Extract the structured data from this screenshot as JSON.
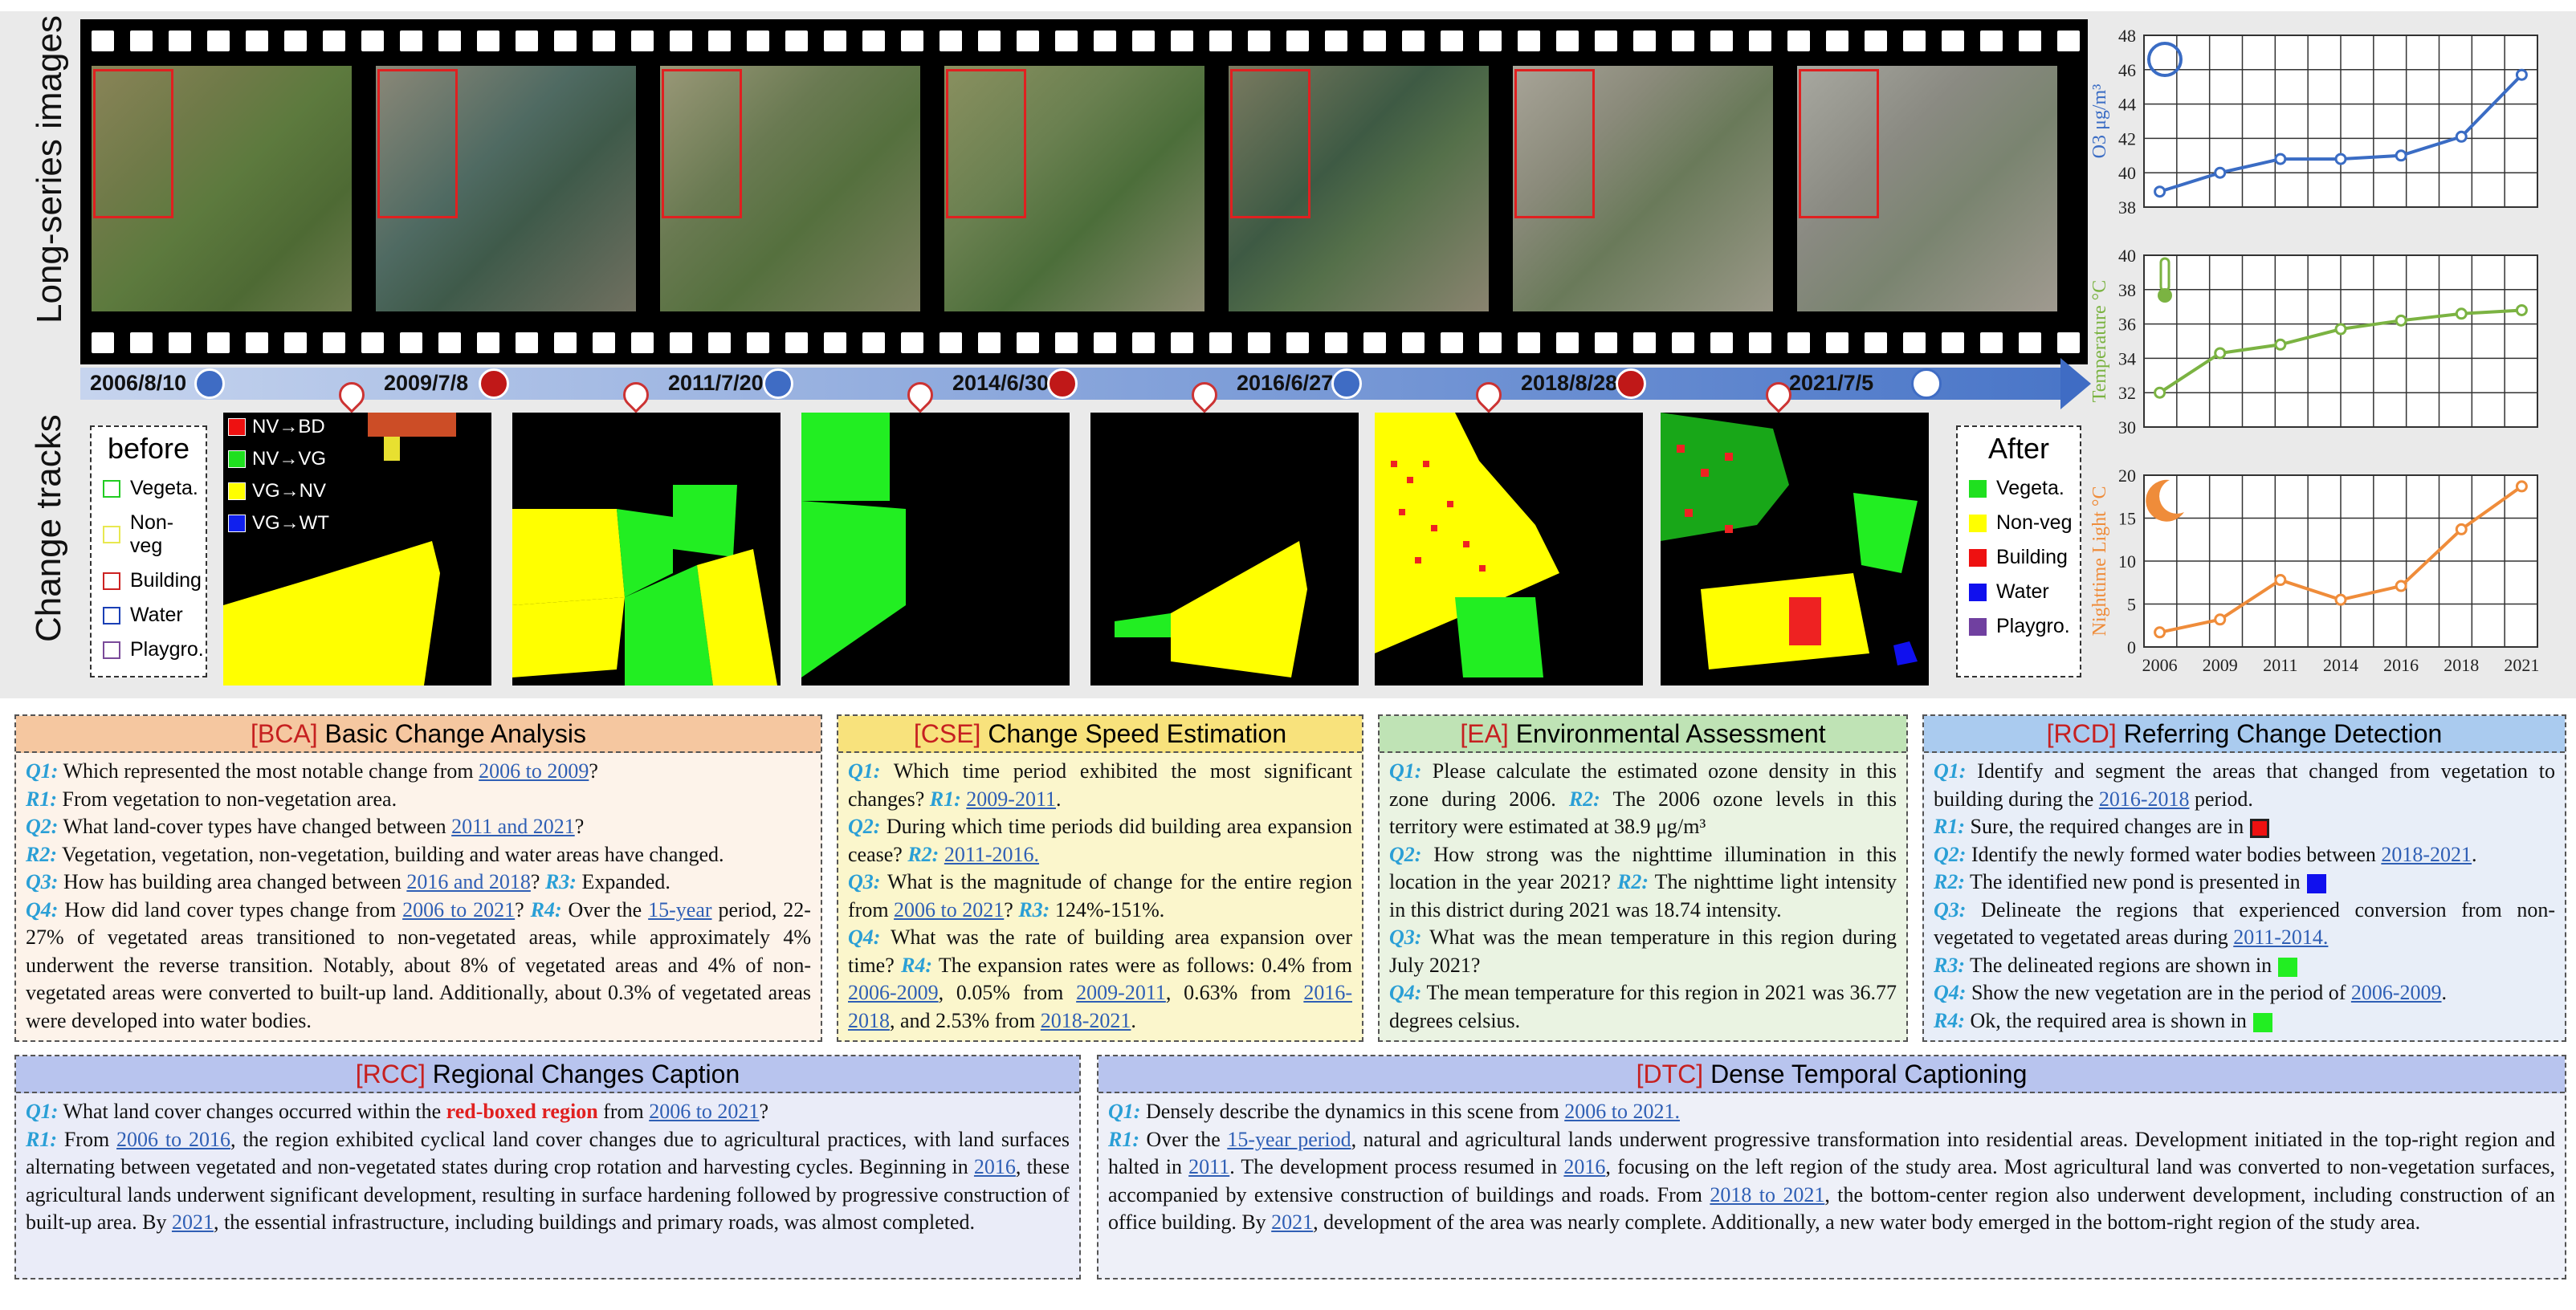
{
  "side_labels": {
    "top": "Long-series images",
    "bottom": "Change tracks"
  },
  "dates": [
    "2006/8/10",
    "2009/7/8",
    "2011/7/20",
    "2014/6/30",
    "2016/6/27",
    "2018/8/28",
    "2021/7/5"
  ],
  "before_legend": {
    "title": "before",
    "items": [
      {
        "label": "Vegeta.",
        "color": "#22cc22"
      },
      {
        "label": "Non-veg",
        "color": "#e8e850"
      },
      {
        "label": "Building",
        "color": "#cc2222"
      },
      {
        "label": "Water",
        "color": "#1a3fb5"
      },
      {
        "label": "Playgro.",
        "color": "#7a4a9a"
      }
    ]
  },
  "after_legend": {
    "title": "After",
    "items": [
      {
        "label": "Vegeta.",
        "color": "#1fe01f"
      },
      {
        "label": "Non-veg",
        "color": "#ffff00"
      },
      {
        "label": "Building",
        "color": "#ee1111"
      },
      {
        "label": "Water",
        "color": "#1010ee"
      },
      {
        "label": "Playgro.",
        "color": "#7040a0"
      }
    ]
  },
  "transition_legend": [
    {
      "label": "NV→BD",
      "color": "#ee1111"
    },
    {
      "label": "NV→VG",
      "color": "#1fe01f"
    },
    {
      "label": "VG→NV",
      "color": "#ffff00"
    },
    {
      "label": "VG→WT",
      "color": "#1020ee"
    }
  ],
  "chart_data": [
    {
      "type": "line",
      "x": [
        "2006",
        "2009",
        "2011",
        "2014",
        "2016",
        "2018",
        "2021"
      ],
      "series": [
        {
          "values": [
            38.9,
            40.0,
            40.8,
            40.8,
            41.0,
            42.1,
            45.7
          ]
        }
      ],
      "ylabel": "O3  μg/m³",
      "ylim": [
        38,
        48
      ],
      "yticks": [
        38,
        40,
        42,
        44,
        46,
        48
      ],
      "color": "#3a6cc4",
      "icon": "ozone-icon"
    },
    {
      "type": "line",
      "x": [
        "2006",
        "2009",
        "2011",
        "2014",
        "2016",
        "2018",
        "2021"
      ],
      "series": [
        {
          "values": [
            32.0,
            34.3,
            34.8,
            35.7,
            36.2,
            36.6,
            36.8
          ]
        }
      ],
      "ylabel": "Temperature °C",
      "ylim": [
        30,
        40
      ],
      "yticks": [
        30,
        32,
        34,
        36,
        38,
        40
      ],
      "color": "#7bb342",
      "icon": "thermometer-icon"
    },
    {
      "type": "line",
      "x": [
        "2006",
        "2009",
        "2011",
        "2014",
        "2016",
        "2018",
        "2021"
      ],
      "series": [
        {
          "values": [
            1.7,
            3.2,
            7.8,
            5.5,
            7.1,
            13.7,
            18.7
          ]
        }
      ],
      "ylabel": "Nighttime Light °C",
      "ylim": [
        0,
        20
      ],
      "yticks": [
        0,
        5,
        10,
        15,
        20
      ],
      "color": "#ef8c3a",
      "icon": "moon-icon",
      "xticks": true
    }
  ],
  "panels": {
    "bca": {
      "tag": "[BCA]",
      "title": " Basic Change Analysis",
      "bg": "#fdf3ea",
      "head": "#f5c7a0"
    },
    "cse": {
      "tag": "[CSE]",
      "title": " Change Speed Estimation",
      "bg": "#fbf6cc",
      "head": "#f8e27c"
    },
    "ea": {
      "tag": "[EA]",
      "title": " Environmental Assessment",
      "bg": "#eaf3e2",
      "head": "#bfe3b5"
    },
    "rcd": {
      "tag": "[RCD]",
      "title": " Referring Change Detection",
      "bg": "#e8eef8",
      "head": "#aacbef"
    },
    "rcc": {
      "tag": "[RCC]",
      "title": " Regional Changes Caption",
      "bg": "#eaecf8",
      "head": "#b8c4ee"
    },
    "dtc": {
      "tag": "[DTC]",
      "title": " Dense Temporal Captioning",
      "bg": "#eef0f8",
      "head": "#b8c4ee"
    }
  },
  "text": {
    "bca": {
      "q1l": "Q1:",
      "q1a": " Which represented the most notable change from ",
      "q1u": "2006 to 2009",
      "q1b": "?",
      "r1l": "R1:",
      "r1a": " From vegetation to non-vegetation area.",
      "q2l": "Q2:",
      "q2a": " What land-cover types have changed between ",
      "q2u": "2011 and 2021",
      "q2b": "?",
      "r2l": "R2:",
      "r2a": " Vegetation, vegetation, non-vegetation, building and water areas have changed.",
      "q3l": "Q3:",
      "q3a": " How has building area changed between ",
      "q3u": "2016 and 2018",
      "q3b": "? ",
      "r3l": "R3:",
      "r3a": " Expanded.",
      "q4l": "Q4:",
      "q4a": " How did land cover types change from ",
      "q4u": "2006 to 2021",
      "q4b": "? ",
      "r4l": "R4:",
      "r4a": " Over the ",
      "r4u": "15-year",
      "r4b": " period, 22-27% of vegetated areas transitioned to non-vegetated areas, while approximately 4% underwent the reverse transition. Notably, about 8% of vegetated areas and 4% of non-vegetated areas were converted to built-up land. Additionally, about 0.3% of vegetated areas were developed into water bodies."
    },
    "cse": {
      "q1l": "Q1:",
      "q1a": " Which time period exhibited the most significant changes? ",
      "r1l": "R1:",
      "r1a": " ",
      "r1u": "2009-2011",
      "r1b": ".",
      "q2l": "Q2:",
      "q2a": " During which time periods did building area expansion cease? ",
      "r2l": "R2:",
      "r2a": " ",
      "r2u": "2011-2016.",
      "q3l": "Q3:",
      "q3a": " What is the magnitude of change for the entire region from ",
      "q3u": "2006 to 2021",
      "q3b": "? ",
      "r3l": "R3:",
      "r3a": " 124%-151%.",
      "q4l": "Q4:",
      "q4a": " What was the rate of building area expansion over time? ",
      "r4l": "R4:",
      "r4a": " The expansion rates were as follows: 0.4% from ",
      "u1": "2006-2009",
      "t1": ", 0.05% from ",
      "u2": "2009-2011",
      "t2": ", 0.63% from ",
      "u3": "2016-2018",
      "t3": ", and 2.53% from ",
      "u4": "2018-2021",
      "t4": "."
    },
    "ea": {
      "q1l": "Q1:",
      "q1a": " Please calculate the estimated ozone density in this zone during 2006. ",
      "r1l": "R2:",
      "r1a": " The 2006 ozone levels in this territory were estimated at 38.9 μg/m³",
      "q2l": "Q2:",
      "q2a": " How strong was the nighttime illumination in this location in the year 2021? ",
      "r2l": "R2:",
      "r2a": " The nighttime light intensity in this district during 2021 was 18.74 intensity.",
      "q3l": "Q3:",
      "q3a": " What was the mean temperature in this region during July 2021?",
      "q4l": "Q4:",
      "q4a": " The mean temperature for this region in 2021 was 36.77 degrees celsius."
    },
    "rcd": {
      "q1l": "Q1:",
      "q1a": " Identify and segment the areas that changed from vegetation to building during the ",
      "q1u": "2016-2018",
      "q1b": " period.",
      "r1l": "R1:",
      "r1a": " Sure, the required changes are in",
      "q2l": "Q2:",
      "q2a": " Identify the newly formed water bodies between ",
      "q2u": "2018-2021",
      "q2b": ".",
      "r2l": "R2:",
      "r2a": " The identified new pond is presented in",
      "q3l": "Q3:",
      "q3a": " Delineate the regions that experienced conversion from non-vegetated to vegetated areas during ",
      "q3u": "2011-2014.",
      "r3l": "R3:",
      "r3a": " The delineated regions are shown in",
      "q4l": "Q4:",
      "q4a": " Show the new vegetation are in the period of ",
      "q4u": "2006-2009",
      "q4b": ".",
      "r4l": "R4:",
      "r4a": " Ok, the required area is shown in"
    },
    "rcc": {
      "q1l": "Q1:",
      "q1a": " What land cover changes occurred within the ",
      "q1r": "red-boxed region",
      "q1b": " from ",
      "q1u": "2006 to 2021",
      "q1c": "?",
      "r1l": "R1:",
      "r1a": " From ",
      "r1u": "2006 to 2016",
      "r1b": ", the region exhibited cyclical land cover changes due to agricultural practices, with land surfaces alternating between vegetated and non-vegetated states during crop rotation and harvesting cycles. Beginning in ",
      "r1u2": "2016",
      "r1c": ", these agricultural lands underwent significant development, resulting in surface hardening followed by progressive construction of built-up area. By ",
      "r1u3": "2021",
      "r1d": ", the essential infrastructure, including buildings and primary roads, was almost completed."
    },
    "dtc": {
      "q1l": "Q1:",
      "q1a": " Densely describe the dynamics in this scene from ",
      "q1u": "2006 to 2021.",
      "r1l": "R1:",
      "r1a": " Over the ",
      "r1u": "15-year period",
      "r1b": ", natural and agricultural lands underwent progressive transformation into residential areas. Development initiated in the top-right region and halted in ",
      "r1u2": "2011",
      "r1c": ". The development process resumed in ",
      "r1u3": "2016",
      "r1d": ", focusing on the left region of the study area. Most agricultural land was converted to non-vegetation surfaces, accompanied by extensive construction of buildings and roads. From ",
      "r1u4": "2018 to 2021",
      "r1e": ", the bottom-center region also underwent development, including construction of an office building. By ",
      "r1u5": "2021",
      "r1f": ", development of the area was nearly complete. Additionally, a new water body emerged in the bottom-right region of the study area."
    }
  }
}
